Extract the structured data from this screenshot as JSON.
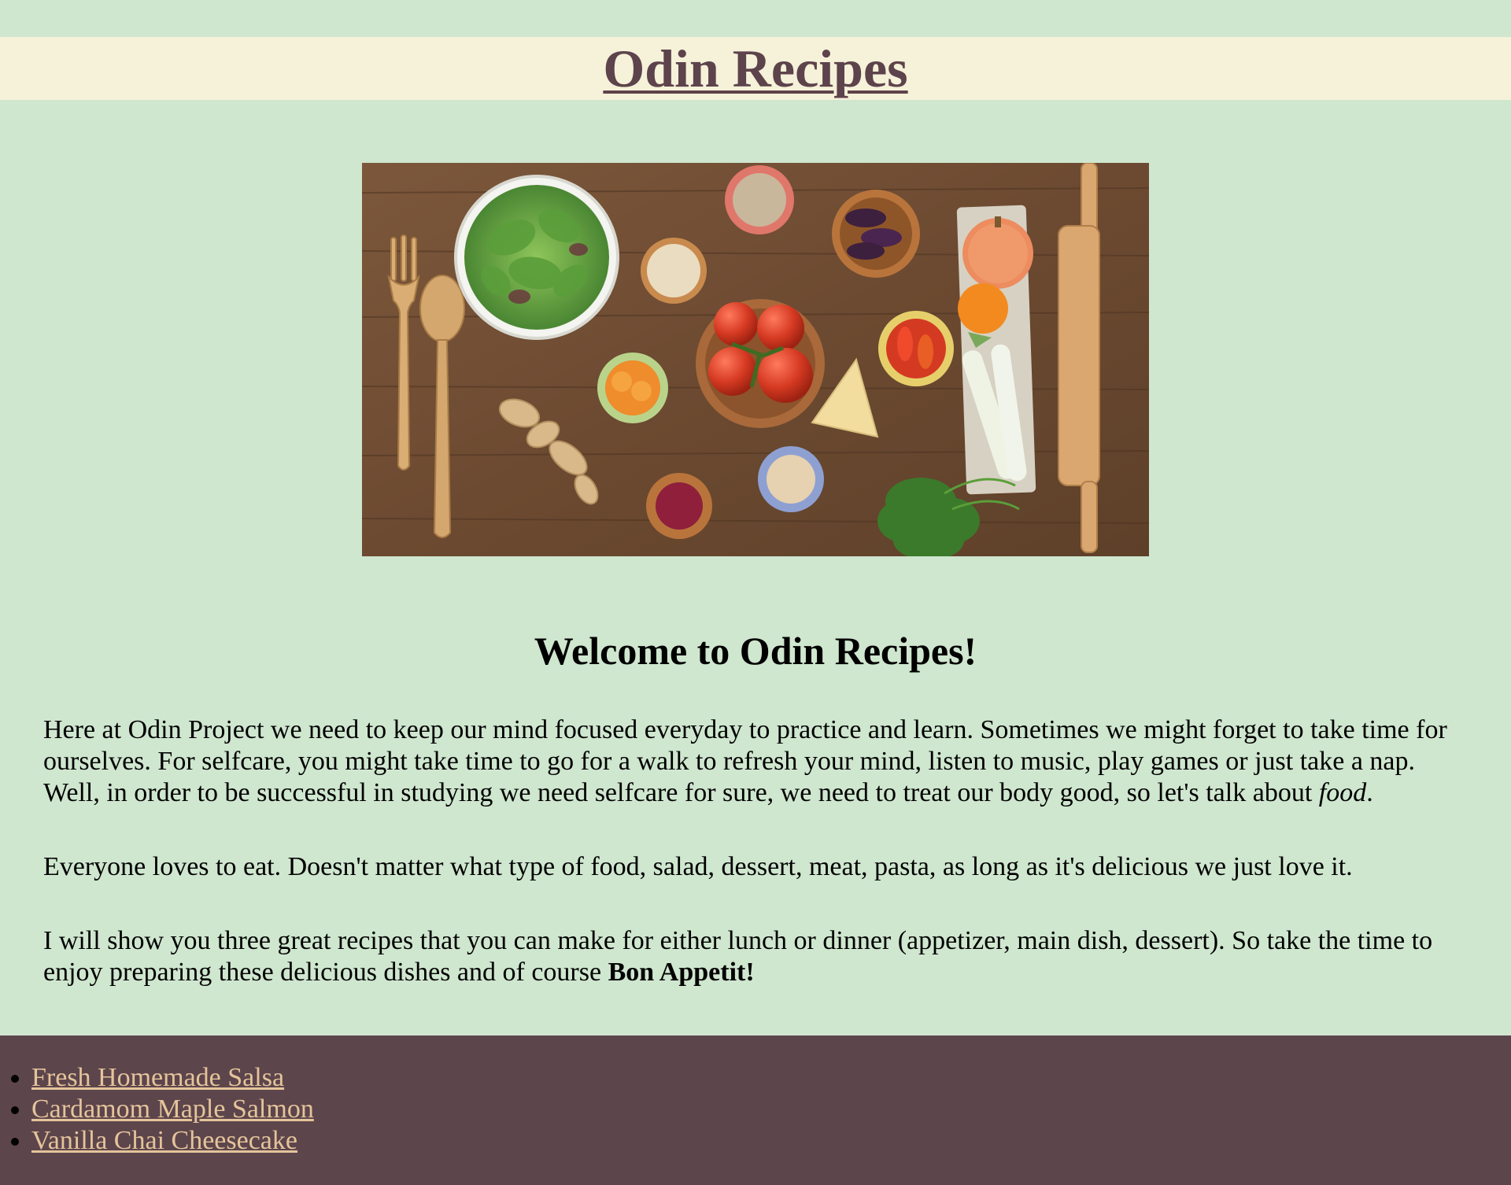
{
  "header": {
    "site_title": "Odin Recipes"
  },
  "hero": {
    "image_description": ""
  },
  "main": {
    "heading": "Welcome to Odin Recipes!",
    "paragraph_1_text": "Here at Odin Project we need to keep our mind focused everyday to practice and learn. Sometimes we might forget to take time for ourselves. For selfcare, you might take time to go for a walk to refresh your mind, listen to music, play games or just take a nap. Well, in order to be successful in studying we need selfcare for sure, we need to treat our body good, so let's talk about ",
    "paragraph_1_emphasis": "food",
    "paragraph_1_end": ".",
    "paragraph_2_text": "Everyone loves to eat. Doesn't matter what type of food, salad, dessert, meat, pasta, as long as it's delicious we just love it.",
    "paragraph_3_text": "I will show you three great recipes that you can make for either lunch or dinner (appetizer, main dish, dessert). So take the time to enjoy preparing these delicious dishes and of course ",
    "paragraph_3_strong": "Bon Appetit!"
  },
  "footer": {
    "recipes": [
      {
        "label": "Fresh Homemade Salsa"
      },
      {
        "label": "Cardamom Maple Salmon"
      },
      {
        "label": "Vanilla Chai Cheesecake"
      }
    ]
  },
  "colors": {
    "page_background": "#cfe6cf",
    "header_background": "#f6f1d9",
    "title_color": "#5d434b",
    "footer_background": "#5d454c",
    "link_color": "#e4c49a"
  }
}
